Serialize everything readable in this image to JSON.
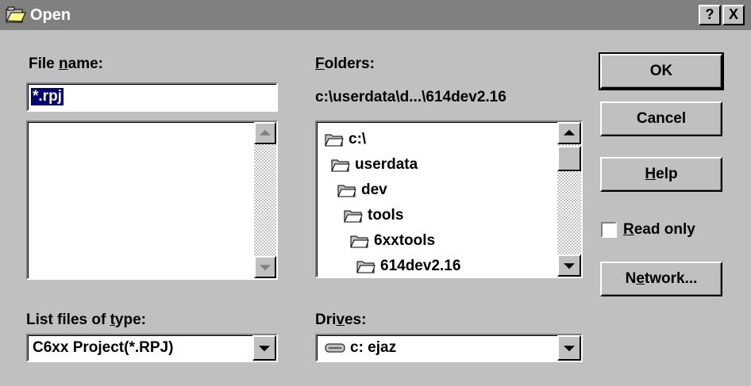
{
  "window": {
    "title": "Open",
    "help_btn": "?",
    "close_btn": "X",
    "icon": "open-folder-icon"
  },
  "file_name": {
    "label_pre": "File ",
    "label_key": "n",
    "label_post": "ame:",
    "value": "*.rpj"
  },
  "folders": {
    "label_key": "F",
    "label_post": "olders:",
    "current_path": "c:\\userdata\\d...\\614dev2.16",
    "items": [
      "c:\\",
      "userdata",
      "dev",
      "tools",
      "6xxtools",
      "614dev2.16"
    ]
  },
  "file_type": {
    "label_pre": "List files of ",
    "label_key": "t",
    "label_post": "ype:",
    "value": "C6xx Project(*.RPJ)"
  },
  "drives": {
    "label_pre": "Dri",
    "label_key": "v",
    "label_post": "es:",
    "value": "c: ejaz"
  },
  "buttons": {
    "ok": "OK",
    "cancel": "Cancel",
    "help_key": "H",
    "help_post": "elp",
    "network_pre": "N",
    "network_key": "e",
    "network_post": "twork..."
  },
  "read_only": {
    "label_key": "R",
    "label_post": "ead only",
    "checked": false
  },
  "colors": {
    "face": "#c0c0c0",
    "title_inactive": "#808080",
    "shadow": "#808080",
    "highlight": "#ffffff"
  }
}
